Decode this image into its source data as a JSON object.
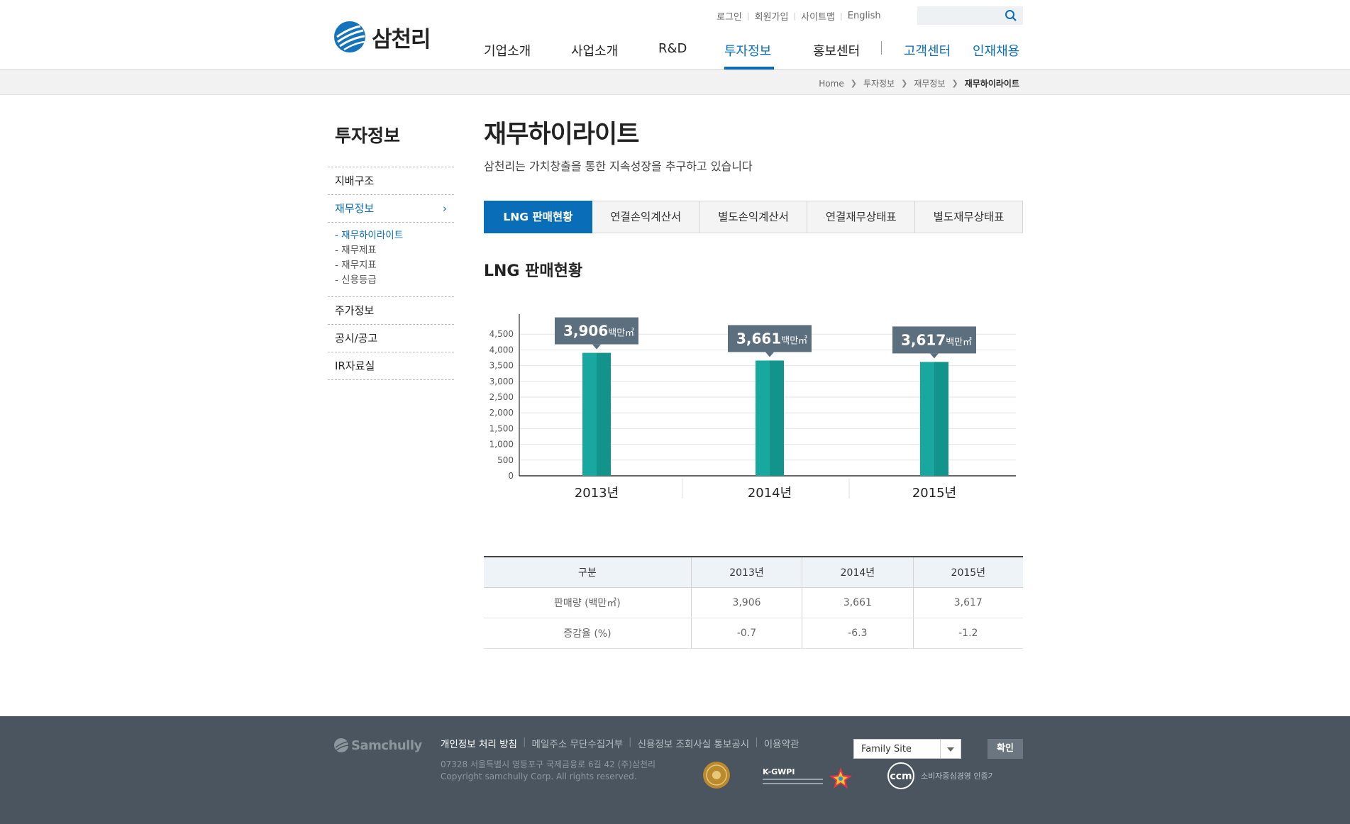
{
  "brand": {
    "name": "삼천리"
  },
  "util": [
    "로그인",
    "회원가입",
    "사이트맵",
    "English"
  ],
  "search": {
    "placeholder": ""
  },
  "gnb": [
    "기업소개",
    "사업소개",
    "R&D",
    "투자정보",
    "홍보센터",
    "고객센터",
    "인재채용"
  ],
  "breadcrumb": [
    "Home",
    "투자정보",
    "재무정보",
    "재무하이라이트"
  ],
  "lnb": {
    "title": "투자정보",
    "items": [
      "지배구조",
      "재무정보",
      "주가정보",
      "공시/공고",
      "IR자료실"
    ],
    "sub": [
      "재무하이라이트",
      "재무제표",
      "재무지표",
      "신용등급"
    ]
  },
  "page": {
    "title": "재무하이라이트",
    "desc": "삼천리는 가치창출을 통한 지속성장을 추구하고 있습니다"
  },
  "tabs": [
    "LNG 판매현황",
    "연결손익계산서",
    "별도손익계산서",
    "연결재무상태표",
    "별도재무상태표"
  ],
  "section_title": "LNG 판매현황",
  "chart_data": {
    "type": "bar",
    "categories": [
      "2013년",
      "2014년",
      "2015년"
    ],
    "values": [
      3906,
      3661,
      3617
    ],
    "value_labels": [
      "3,906",
      "3,661",
      "3,617"
    ],
    "unit": "백만㎥",
    "yticks": [
      "0",
      "500",
      "1,000",
      "1,500",
      "2,000",
      "2,500",
      "3,000",
      "3,500",
      "4,000",
      "4,500"
    ],
    "ylim": [
      0,
      5000
    ],
    "grid": true,
    "colors": {
      "bar": "#18a8a0",
      "bar_dark": "#12948d",
      "label_bg": "#5c6f7e"
    }
  },
  "table": {
    "headers": [
      "구분",
      "2013년",
      "2014년",
      "2015년"
    ],
    "rows": [
      [
        "판매량 (백만㎥)",
        "3,906",
        "3,661",
        "3,617"
      ],
      [
        "증감율 (%)",
        "-0.7",
        "-6.3",
        "-1.2"
      ]
    ]
  },
  "footer": {
    "logo": "Samchully",
    "links": [
      "개인정보 처리 방침",
      "메일주소 무단수집거부",
      "신용정보 조회사실 통보공시",
      "이용약관"
    ],
    "address": "07328 서울특별시 영등포구 국제금융로 6길 42 (주)삼천리",
    "copyright": "Copyright samchully Corp. All rights reserved.",
    "family_site": "Family Site",
    "ok_button": "확인",
    "cert_kgwpi": "K-GWPI",
    "cert_ccm": "소비자중심경영 인증기업"
  },
  "colors": {
    "primary": "#0a6db7",
    "footer_bg": "#4a5560"
  }
}
